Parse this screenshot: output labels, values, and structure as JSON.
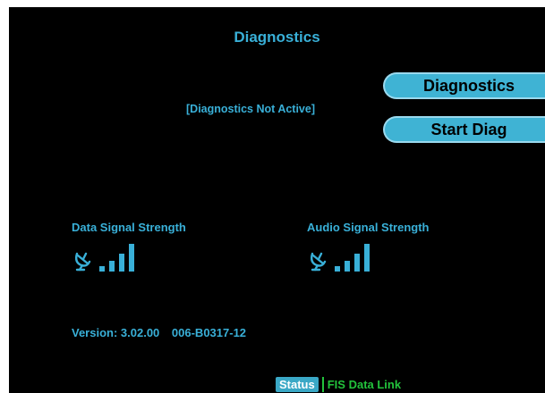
{
  "screen": {
    "title": "Diagnostics",
    "status_message": "[Diagnostics Not Active]"
  },
  "softkeys": {
    "diagnostics_label": "Diagnostics",
    "start_label": "Start Diag"
  },
  "signals": {
    "data_label": "Data Signal Strength",
    "audio_label": "Audio Signal Strength",
    "data_icon": "satellite-dish-icon",
    "audio_icon": "satellite-dish-icon",
    "data_level": 4,
    "audio_level": 4,
    "max_level": 4
  },
  "version": {
    "label": "Version: 3.02.00",
    "part_number": "006-B0317-12"
  },
  "statusbar": {
    "status_tab": "Status",
    "page_name": "FIS Data Link"
  },
  "colors": {
    "accent": "#39b0d8",
    "button": "#3fb3d4",
    "status_green": "#23c33c",
    "background": "#000000"
  }
}
